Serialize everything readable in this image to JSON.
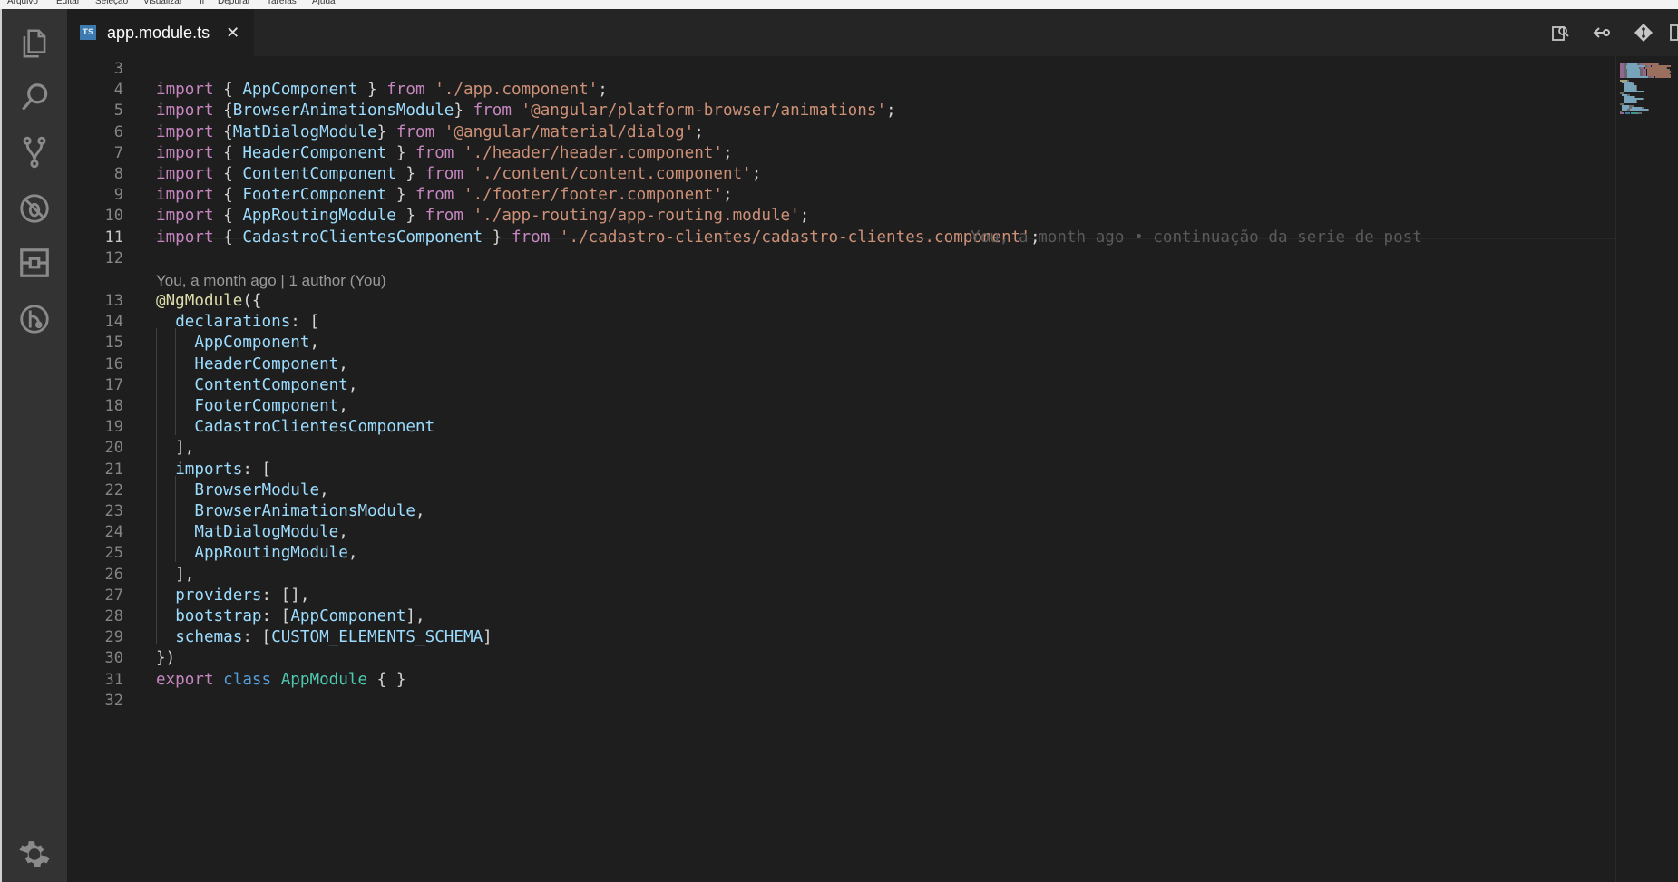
{
  "menu": [
    "Arquivo",
    "Editar",
    "Seleção",
    "Visualizar",
    "Ir",
    "Depurar",
    "Tarefas",
    "Ajuda"
  ],
  "activity_bar": {
    "icons": [
      "explorer-icon",
      "search-icon",
      "source-control-icon",
      "debug-icon",
      "extensions-icon",
      "gitlens-icon"
    ],
    "bottom_icon": "settings-gear-icon"
  },
  "tab": {
    "icon_text": "TS",
    "label": "app.module.ts",
    "close": "✕"
  },
  "editor_actions": [
    "open-changes-icon",
    "go-back-icon",
    "git-compare-icon",
    "split-editor-icon"
  ],
  "codelens": "You, a month ago | 1 author (You)",
  "blame": "You, a month ago • continuação da serie de post",
  "active_line": "11",
  "lines": [
    {
      "n": "3",
      "t": []
    },
    {
      "n": "4",
      "t": [
        [
          "kw",
          "import"
        ],
        [
          "p",
          " { "
        ],
        [
          "id",
          "AppComponent"
        ],
        [
          "p",
          " } "
        ],
        [
          "kw",
          "from"
        ],
        [
          "p",
          " "
        ],
        [
          "str",
          "'./app.component'"
        ],
        [
          "p",
          ";"
        ]
      ]
    },
    {
      "n": "5",
      "t": [
        [
          "kw",
          "import"
        ],
        [
          "p",
          " {"
        ],
        [
          "id",
          "BrowserAnimationsModule"
        ],
        [
          "p",
          "} "
        ],
        [
          "kw",
          "from"
        ],
        [
          "p",
          " "
        ],
        [
          "str",
          "'@angular/platform-browser/animations'"
        ],
        [
          "p",
          ";"
        ]
      ]
    },
    {
      "n": "6",
      "t": [
        [
          "kw",
          "import"
        ],
        [
          "p",
          " {"
        ],
        [
          "id",
          "MatDialogModule"
        ],
        [
          "p",
          "} "
        ],
        [
          "kw",
          "from"
        ],
        [
          "p",
          " "
        ],
        [
          "str",
          "'@angular/material/dialog'"
        ],
        [
          "p",
          ";"
        ]
      ]
    },
    {
      "n": "7",
      "t": [
        [
          "kw",
          "import"
        ],
        [
          "p",
          " { "
        ],
        [
          "id",
          "HeaderComponent"
        ],
        [
          "p",
          " } "
        ],
        [
          "kw",
          "from"
        ],
        [
          "p",
          " "
        ],
        [
          "str",
          "'./header/header.component'"
        ],
        [
          "p",
          ";"
        ]
      ]
    },
    {
      "n": "8",
      "t": [
        [
          "kw",
          "import"
        ],
        [
          "p",
          " { "
        ],
        [
          "id",
          "ContentComponent"
        ],
        [
          "p",
          " } "
        ],
        [
          "kw",
          "from"
        ],
        [
          "p",
          " "
        ],
        [
          "str",
          "'./content/content.component'"
        ],
        [
          "p",
          ";"
        ]
      ]
    },
    {
      "n": "9",
      "t": [
        [
          "kw",
          "import"
        ],
        [
          "p",
          " { "
        ],
        [
          "id",
          "FooterComponent"
        ],
        [
          "p",
          " } "
        ],
        [
          "kw",
          "from"
        ],
        [
          "p",
          " "
        ],
        [
          "str",
          "'./footer/footer.component'"
        ],
        [
          "p",
          ";"
        ]
      ]
    },
    {
      "n": "10",
      "t": [
        [
          "kw",
          "import"
        ],
        [
          "p",
          " { "
        ],
        [
          "id",
          "AppRoutingModule"
        ],
        [
          "p",
          " } "
        ],
        [
          "kw",
          "from"
        ],
        [
          "p",
          " "
        ],
        [
          "str",
          "'./app-routing/app-routing.module'"
        ],
        [
          "p",
          ";"
        ]
      ]
    },
    {
      "n": "11",
      "t": [
        [
          "kw",
          "import"
        ],
        [
          "p",
          " { "
        ],
        [
          "id",
          "CadastroClientesComponent"
        ],
        [
          "p",
          " } "
        ],
        [
          "kw",
          "from"
        ],
        [
          "p",
          " "
        ],
        [
          "str",
          "'./cadastro-clientes/cadastro-clientes.component'"
        ],
        [
          "p",
          ";"
        ]
      ]
    },
    {
      "n": "12",
      "t": []
    },
    {
      "n": "13",
      "t": [
        [
          "fn",
          "@NgModule"
        ],
        [
          "p",
          "({"
        ]
      ]
    },
    {
      "n": "14",
      "t": [
        [
          "p",
          "  "
        ],
        [
          "id",
          "declarations"
        ],
        [
          "p",
          ": ["
        ]
      ]
    },
    {
      "n": "15",
      "t": [
        [
          "p",
          "    "
        ],
        [
          "id",
          "AppComponent"
        ],
        [
          "p",
          ","
        ]
      ]
    },
    {
      "n": "16",
      "t": [
        [
          "p",
          "    "
        ],
        [
          "id",
          "HeaderComponent"
        ],
        [
          "p",
          ","
        ]
      ]
    },
    {
      "n": "17",
      "t": [
        [
          "p",
          "    "
        ],
        [
          "id",
          "ContentComponent"
        ],
        [
          "p",
          ","
        ]
      ]
    },
    {
      "n": "18",
      "t": [
        [
          "p",
          "    "
        ],
        [
          "id",
          "FooterComponent"
        ],
        [
          "p",
          ","
        ]
      ]
    },
    {
      "n": "19",
      "t": [
        [
          "p",
          "    "
        ],
        [
          "id",
          "CadastroClientesComponent"
        ]
      ]
    },
    {
      "n": "20",
      "t": [
        [
          "p",
          "  ],"
        ]
      ]
    },
    {
      "n": "21",
      "t": [
        [
          "p",
          "  "
        ],
        [
          "id",
          "imports"
        ],
        [
          "p",
          ": ["
        ]
      ]
    },
    {
      "n": "22",
      "t": [
        [
          "p",
          "    "
        ],
        [
          "id",
          "BrowserModule"
        ],
        [
          "p",
          ","
        ]
      ]
    },
    {
      "n": "23",
      "t": [
        [
          "p",
          "    "
        ],
        [
          "id",
          "BrowserAnimationsModule"
        ],
        [
          "p",
          ","
        ]
      ]
    },
    {
      "n": "24",
      "t": [
        [
          "p",
          "    "
        ],
        [
          "id",
          "MatDialogModule"
        ],
        [
          "p",
          ","
        ]
      ]
    },
    {
      "n": "25",
      "t": [
        [
          "p",
          "    "
        ],
        [
          "id",
          "AppRoutingModule"
        ],
        [
          "p",
          ","
        ]
      ]
    },
    {
      "n": "26",
      "t": [
        [
          "p",
          "  ],"
        ]
      ]
    },
    {
      "n": "27",
      "t": [
        [
          "p",
          "  "
        ],
        [
          "id",
          "providers"
        ],
        [
          "p",
          ": [],"
        ]
      ]
    },
    {
      "n": "28",
      "t": [
        [
          "p",
          "  "
        ],
        [
          "id",
          "bootstrap"
        ],
        [
          "p",
          ": ["
        ],
        [
          "id",
          "AppComponent"
        ],
        [
          "p",
          "],"
        ]
      ]
    },
    {
      "n": "29",
      "t": [
        [
          "p",
          "  "
        ],
        [
          "id",
          "schemas"
        ],
        [
          "p",
          ": ["
        ],
        [
          "id",
          "CUSTOM_ELEMENTS_SCHEMA"
        ],
        [
          "p",
          "]"
        ]
      ]
    },
    {
      "n": "30",
      "t": [
        [
          "p",
          "})"
        ]
      ]
    },
    {
      "n": "31",
      "t": [
        [
          "kw",
          "export"
        ],
        [
          "p",
          " "
        ],
        [
          "kb",
          "class"
        ],
        [
          "p",
          " "
        ],
        [
          "cls",
          "AppModule"
        ],
        [
          "p",
          " { }"
        ]
      ]
    },
    {
      "n": "32",
      "t": []
    }
  ],
  "colors": {
    "keyword": "#c586c0",
    "storage": "#569cd6",
    "string": "#ce9178",
    "variable": "#9cdcfe",
    "class": "#4ec9b0",
    "decorator": "#dcdcaa",
    "background": "#1e1e1e",
    "activity_bar": "#333333"
  }
}
